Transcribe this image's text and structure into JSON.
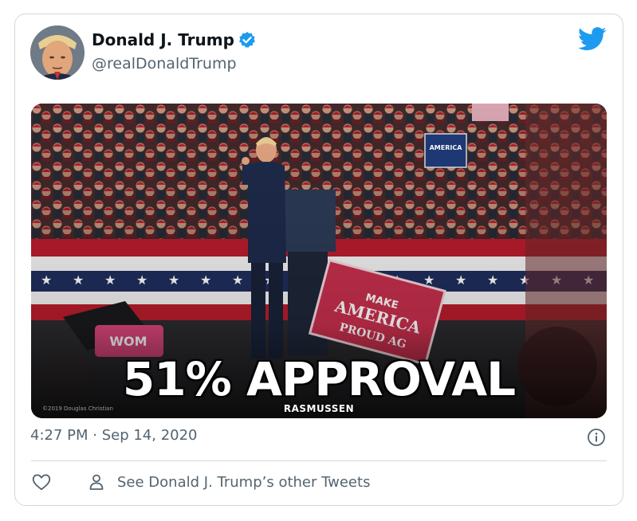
{
  "author": {
    "display_name": "Donald J. Trump",
    "handle": "@realDonaldTrump",
    "verified": true,
    "avatar_icon": "profile-photo",
    "verified_icon": "verified-badge-icon"
  },
  "brand": {
    "icon": "twitter-bird-icon",
    "color": "#1d9bf0"
  },
  "media": {
    "headline": "51% APPROVAL",
    "source": "RASMUSSEN",
    "photo_credit": "©2019 Douglas Christian",
    "sign_text": "MAKE AMERICA PROUD AGAIN",
    "back_sign_text": "MAKE AMERICA STRONG AGAIN"
  },
  "timestamp": "4:27 PM · Sep 14, 2020",
  "info_icon": "info-icon",
  "actions": {
    "like_icon": "heart-icon",
    "profile_icon": "person-icon",
    "other_tweets_label": "See Donald J. Trump’s other Tweets"
  }
}
